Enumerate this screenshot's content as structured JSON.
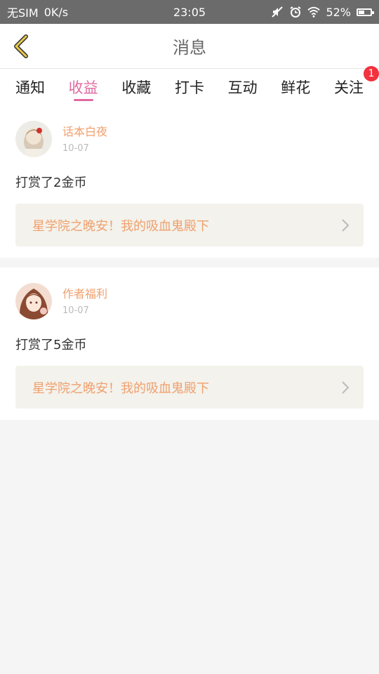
{
  "status_bar": {
    "carrier": "无SIM",
    "net_speed": "0K/s",
    "time": "23:05",
    "battery": "52%",
    "battery_level": 0.52,
    "icons": [
      "mute-icon",
      "alarm-icon",
      "wifi-icon",
      "battery-icon"
    ]
  },
  "nav": {
    "title": "消息",
    "back_icon": "chevron-left-icon"
  },
  "tabs": [
    {
      "label": "通知",
      "active": false
    },
    {
      "label": "收益",
      "active": true
    },
    {
      "label": "收藏",
      "active": false
    },
    {
      "label": "打卡",
      "active": false
    },
    {
      "label": "互动",
      "active": false
    },
    {
      "label": "鲜花",
      "active": false
    },
    {
      "label": "关注",
      "active": false,
      "badge": "1"
    }
  ],
  "messages": [
    {
      "user": "话本白夜",
      "date": "10-07",
      "text": "打赏了2金币",
      "book": "星学院之晚安！我的吸血鬼殿下"
    },
    {
      "user": "作者福利",
      "date": "10-07",
      "text": "打赏了5金币",
      "book": "星学院之晚安！我的吸血鬼殿下"
    }
  ],
  "colors": {
    "accent": "#e06aa0",
    "highlight": "#f0a06e",
    "badge": "#f2323f",
    "status_bar": "#6b6b6b",
    "back_arrow": "#e8c84a"
  }
}
